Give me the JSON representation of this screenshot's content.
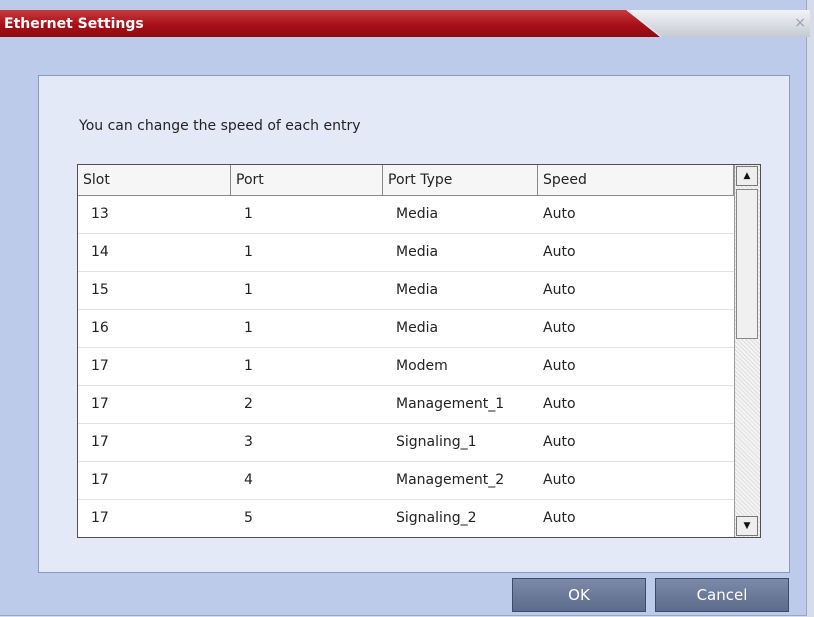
{
  "window": {
    "title": "Ethernet Settings",
    "close_symbol": "×"
  },
  "instruction": "You can change the speed of each entry",
  "table": {
    "columns": [
      "Slot",
      "Port",
      "Port Type",
      "Speed"
    ],
    "rows": [
      [
        "13",
        "1",
        "Media",
        "Auto"
      ],
      [
        "14",
        "1",
        "Media",
        "Auto"
      ],
      [
        "15",
        "1",
        "Media",
        "Auto"
      ],
      [
        "16",
        "1",
        "Media",
        "Auto"
      ],
      [
        "17",
        "1",
        "Modem",
        "Auto"
      ],
      [
        "17",
        "2",
        "Management_1",
        "Auto"
      ],
      [
        "17",
        "3",
        "Signaling_1",
        "Auto"
      ],
      [
        "17",
        "4",
        "Management_2",
        "Auto"
      ],
      [
        "17",
        "5",
        "Signaling_2",
        "Auto"
      ]
    ],
    "scroll_up_icon": "triangle-up",
    "scroll_down_icon": "triangle-down"
  },
  "buttons": {
    "ok": "OK",
    "cancel": "Cancel"
  },
  "colors": {
    "title_bar": "#a90f18",
    "panel": "#e4e9f8",
    "button": "#6b7898"
  }
}
